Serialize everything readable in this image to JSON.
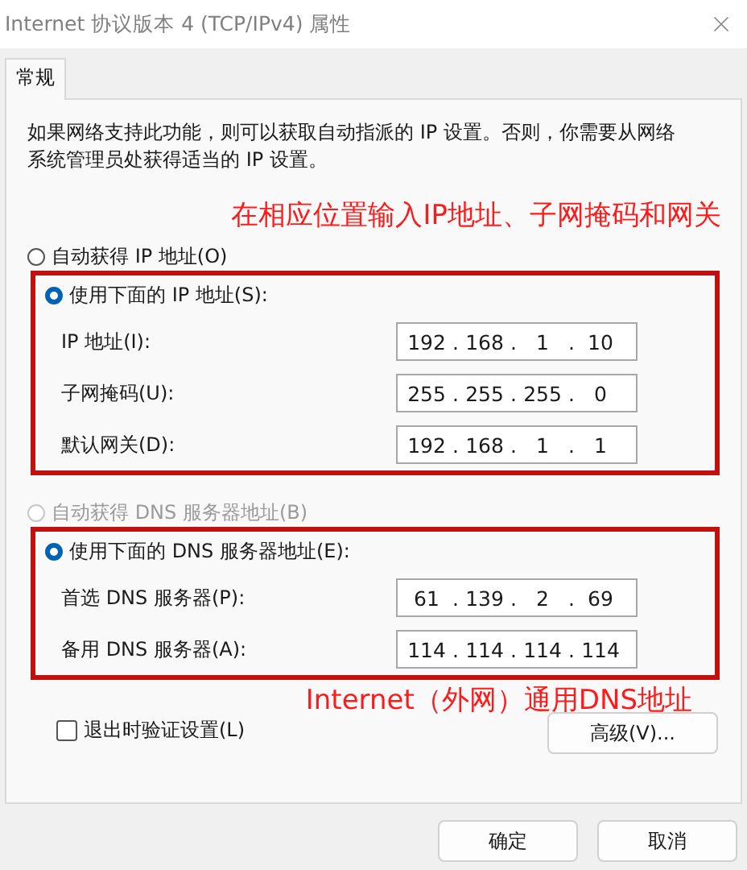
{
  "window": {
    "title": "Internet 协议版本 4 (TCP/IPv4) 属性"
  },
  "tabs": [
    {
      "label": "常规",
      "selected": true
    }
  ],
  "description": "如果网络支持此功能，则可以获取自动指派的 IP 设置。否则，你需要从网络系统管理员处获得适当的 IP 设置。",
  "ip_section": {
    "octet_separator": ".",
    "annotation": "在相应位置输入IP地址、子网掩码和网关",
    "auto_option": {
      "label": "自动获得 IP 地址(O)",
      "selected": false,
      "disabled": false
    },
    "manual_option": {
      "label": "使用下面的 IP 地址(S):",
      "selected": true,
      "disabled": false
    },
    "highlighted": true,
    "fields": [
      {
        "label": "IP 地址(I):",
        "octets": [
          "192",
          "168",
          "1",
          "10"
        ]
      },
      {
        "label": "子网掩码(U):",
        "octets": [
          "255",
          "255",
          "255",
          "0"
        ]
      },
      {
        "label": "默认网关(D):",
        "octets": [
          "192",
          "168",
          "1",
          "1"
        ]
      }
    ]
  },
  "dns_section": {
    "octet_separator": ".",
    "annotation": "Internet（外网）通用DNS地址",
    "auto_option": {
      "label": "自动获得 DNS 服务器地址(B)",
      "selected": false,
      "disabled": true
    },
    "manual_option": {
      "label": "使用下面的 DNS 服务器地址(E):",
      "selected": true,
      "disabled": false
    },
    "highlighted": true,
    "fields": [
      {
        "label": "首选 DNS 服务器(P):",
        "octets": [
          "61",
          "139",
          "2",
          "69"
        ]
      },
      {
        "label": "备用 DNS 服务器(A):",
        "octets": [
          "114",
          "114",
          "114",
          "114"
        ]
      }
    ]
  },
  "validate_checkbox": {
    "label": "退出时验证设置(L)",
    "checked": false
  },
  "advanced_button": "高级(V)...",
  "buttons": [
    "确定",
    "取消"
  ]
}
